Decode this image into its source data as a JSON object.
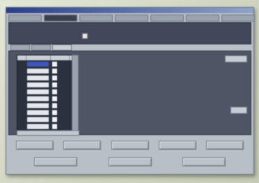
{
  "window": {
    "title": ""
  },
  "menubar": {
    "tabs": [
      "",
      "",
      "",
      "",
      "",
      "",
      ""
    ],
    "active_index": 1
  },
  "header": {
    "row1_label": "",
    "row1_value": "",
    "row2_label": "",
    "row2_value": ""
  },
  "subtabs": {
    "items": [
      "",
      "",
      ""
    ],
    "active_index": 2
  },
  "list": {
    "columns": [
      "",
      "",
      ""
    ],
    "rows": [
      {
        "num": "",
        "name": "",
        "selected": true
      },
      {
        "num": "",
        "name": "",
        "selected": false
      },
      {
        "num": "",
        "name": "",
        "selected": false
      },
      {
        "num": "",
        "name": "",
        "selected": false
      },
      {
        "num": "",
        "name": "",
        "selected": false
      },
      {
        "num": "",
        "name": "",
        "selected": false
      },
      {
        "num": "",
        "name": "",
        "selected": false
      },
      {
        "num": "",
        "name": "",
        "selected": false
      },
      {
        "num": "",
        "name": "",
        "selected": false
      },
      {
        "num": "",
        "name": "",
        "selected": false
      }
    ]
  },
  "details": {
    "fields": [
      {
        "label": "",
        "value": ""
      },
      {
        "label": "",
        "value": ""
      },
      {
        "label": "",
        "value": ""
      },
      {
        "label": "",
        "value": ""
      },
      {
        "label": "",
        "value": ""
      },
      {
        "label": "",
        "value": ""
      },
      {
        "label": "",
        "value": ""
      }
    ],
    "top_right_button": "",
    "bottom_right_button": ""
  },
  "bottom_buttons_row1": [
    "",
    "",
    "",
    "",
    ""
  ],
  "bottom_buttons_row2": [
    "",
    "",
    ""
  ],
  "colors": {
    "panel_dark": "#505565",
    "selection": "#3c57b8",
    "title_bar": "#2a3f8a"
  }
}
